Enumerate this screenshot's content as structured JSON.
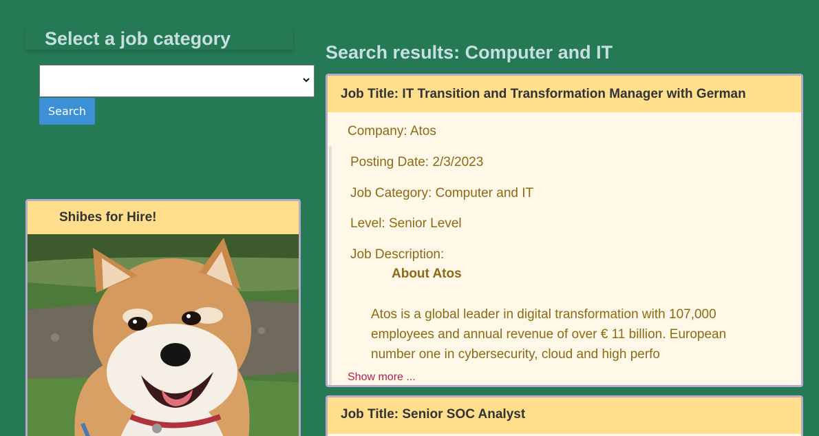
{
  "sidebar": {
    "category_title": "Select a job category",
    "select_value": "",
    "search_label": "Search",
    "promo": {
      "title": "Shibes for Hire!",
      "image_icon": "shiba-inu-dog-photo"
    }
  },
  "results": {
    "heading": "Search results: Computer and IT",
    "jobs": [
      {
        "title": "Job Title: IT Transition and Transformation Manager with German",
        "company": "Company: Atos",
        "posting_date": "Posting Date: 2/3/2023",
        "category": "Job Category: Computer and IT",
        "level": "Level: Senior Level",
        "description_label": "Job Description:",
        "about_heading": "About Atos",
        "description": "Atos is a global leader in digital transformation with 107,000 employees and annual revenue of over € 11 billion. European number one in cybersecurity, cloud and high perfo",
        "show_more": "Show more ..."
      },
      {
        "title": "Job Title: Senior SOC Analyst"
      }
    ]
  },
  "colors": {
    "background": "#257a55",
    "card_header": "#ffde8c",
    "card_body": "#fff8e8",
    "card_border": "#b8a9c9",
    "heading_text": "#c7dfe3",
    "field_text": "#8a6a12",
    "link": "#b0214f",
    "button": "#3d8fd6"
  }
}
